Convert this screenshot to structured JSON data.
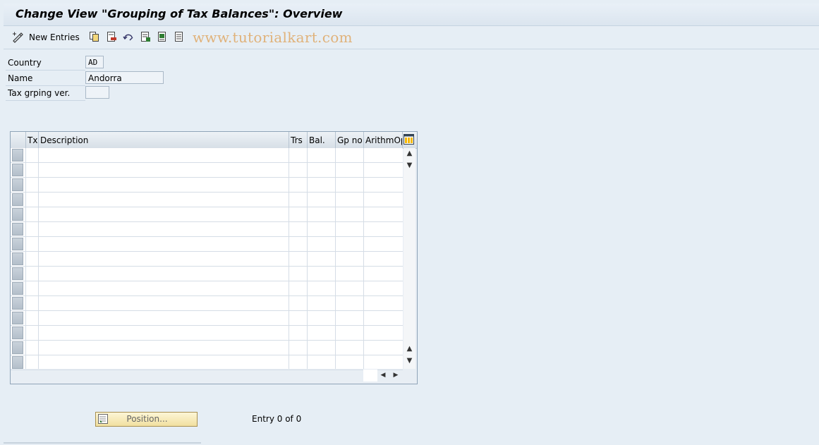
{
  "title": "Change View \"Grouping of Tax Balances\": Overview",
  "toolbar": {
    "new_entries_label": "New Entries",
    "watermark": "www.tutorialkart.com"
  },
  "fields": {
    "country": {
      "label": "Country",
      "value": "AD"
    },
    "name": {
      "label": "Name",
      "value": "Andorra"
    },
    "tax_grping_ver": {
      "label": "Tax grping ver.",
      "value": ""
    }
  },
  "table": {
    "columns": [
      "Tx",
      "Description",
      "Trs",
      "Bal.",
      "Gp no",
      "ArithmOp"
    ],
    "row_count_visible": 15
  },
  "footer": {
    "position_button": "Position...",
    "entry_text": "Entry 0 of 0"
  },
  "colors": {
    "background": "#e6eef5",
    "watermark": "#e0b27a",
    "position_button": "#f1e0a0"
  }
}
